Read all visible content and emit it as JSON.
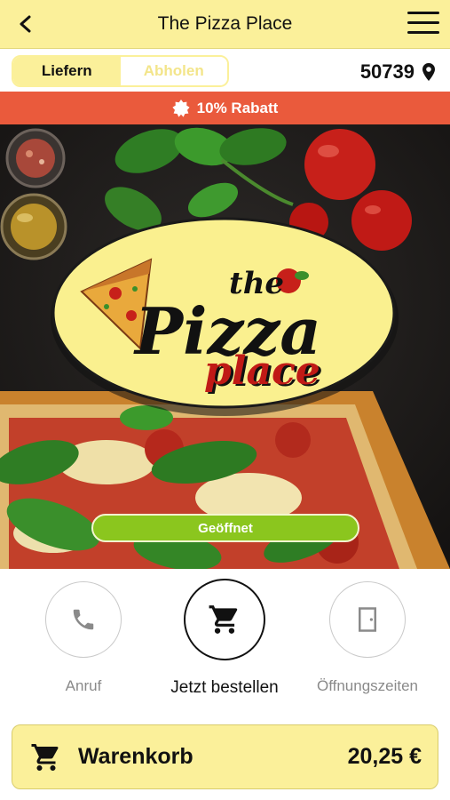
{
  "header": {
    "title": "The Pizza Place",
    "back_icon": "chevron-left-icon",
    "menu_icon": "hamburger-menu-icon"
  },
  "mode": {
    "deliver_label": "Liefern",
    "pickup_label": "Abholen",
    "selected": "Liefern"
  },
  "location": {
    "zip": "50739",
    "icon": "location-pin-icon"
  },
  "promo": {
    "text": "10% Rabatt",
    "icon": "badge-icon"
  },
  "logo": {
    "the": "the",
    "pizza": "Pizza",
    "place": "place"
  },
  "status": {
    "label": "Geöffnet"
  },
  "actions": {
    "call_label": "Anruf",
    "order_label": "Jetzt bestellen",
    "hours_label": "Öffnungszeiten"
  },
  "cart": {
    "label": "Warenkorb",
    "total": "20,25 €"
  },
  "colors": {
    "brand_yellow": "#fbf09a",
    "promo_red": "#ea5a3c",
    "open_green": "#8bc61e"
  }
}
